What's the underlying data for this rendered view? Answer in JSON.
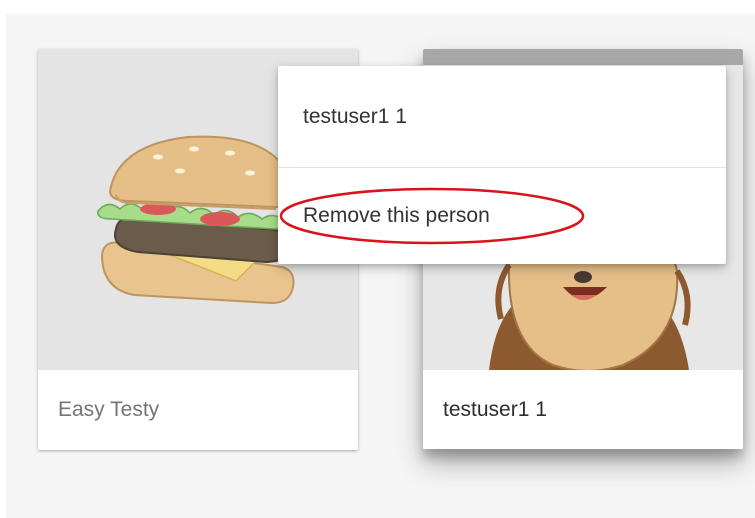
{
  "cards": [
    {
      "name": "Easy Testy",
      "avatar_icon": "hamburger-icon"
    },
    {
      "name": "testuser1 1",
      "avatar_icon": "monkey-avatar-icon"
    }
  ],
  "context_menu": {
    "header": "testuser1 1",
    "remove_label": "Remove this person"
  },
  "colors": {
    "background": "#f5f5f5",
    "annotation": "#d9131c"
  }
}
